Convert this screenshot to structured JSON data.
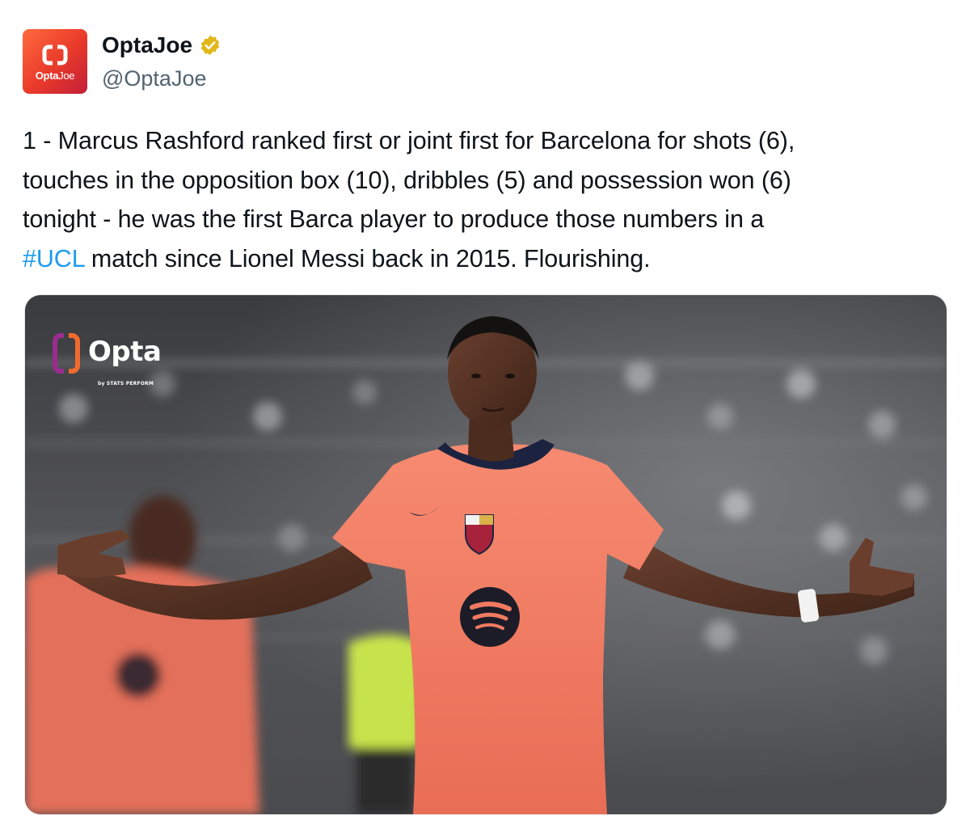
{
  "author": {
    "display_name": "OptaJoe",
    "handle": "@OptaJoe",
    "verified": true,
    "avatar_text_bold": "Opta",
    "avatar_text_light": "Joe"
  },
  "tweet": {
    "lines": [
      "1 - Marcus Rashford ranked first or joint first for Barcelona for shots (6),",
      "touches in the opposition box (10), dribbles (5) and possession won (6)",
      "tonight - he was the first Barca player to produce those numbers in a"
    ],
    "hashtag": "#UCL",
    "last_line_rest": " match since Lionel Messi back in 2015. Flourishing."
  },
  "media": {
    "logo_text": "Opta",
    "logo_subtext": "by STATS PERFORM"
  },
  "colors": {
    "hashtag": "#1d9bf0",
    "verified": "#e2b719",
    "kit": "#f0785f"
  }
}
